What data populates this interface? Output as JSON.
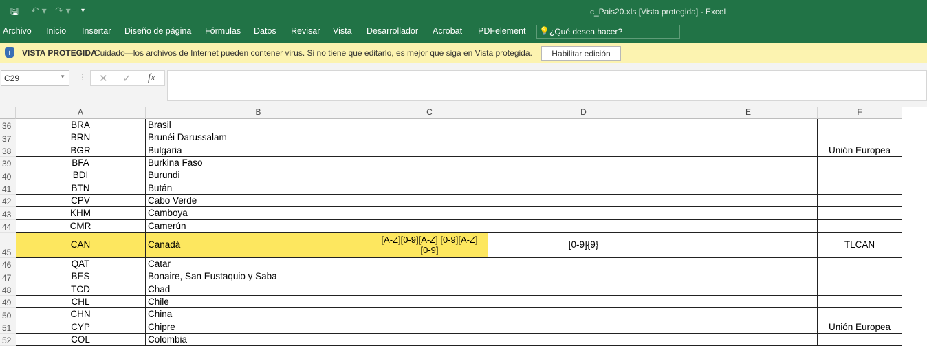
{
  "titlebar": {
    "filename": "c_Pais20.xls  [Vista protegida] - Excel",
    "icons": [
      "save-icon",
      "undo-icon",
      "redo-icon",
      "customize-icon"
    ]
  },
  "ribbon": {
    "tabs": [
      "Archivo",
      "Inicio",
      "Insertar",
      "Diseño de página",
      "Fórmulas",
      "Datos",
      "Revisar",
      "Vista",
      "Desarrollador",
      "Acrobat",
      "PDFelement"
    ],
    "tell_me": "¿Qué desea hacer?"
  },
  "protected": {
    "title": "VISTA PROTEGIDA",
    "message": "Cuidado—los archivos de Internet pueden contener virus. Si no tiene que editarlo, es mejor que siga en Vista protegida.",
    "button": "Habilitar edición"
  },
  "formula_bar": {
    "name_box": "C29",
    "cancel": "✕",
    "enter": "✓",
    "fx": "fx",
    "value": ""
  },
  "columns": [
    "A",
    "B",
    "C",
    "D",
    "E",
    "F"
  ],
  "highlight_color": "#fde75f",
  "rows": [
    {
      "n": "36",
      "A": "BRA",
      "B": "Brasil",
      "C": "",
      "D": "",
      "E": "",
      "F": ""
    },
    {
      "n": "37",
      "A": "BRN",
      "B": "Brunéi Darussalam",
      "C": "",
      "D": "",
      "E": "",
      "F": ""
    },
    {
      "n": "38",
      "A": "BGR",
      "B": "Bulgaria",
      "C": "",
      "D": "",
      "E": "",
      "F": "Unión Europea"
    },
    {
      "n": "39",
      "A": "BFA",
      "B": "Burkina Faso",
      "C": "",
      "D": "",
      "E": "",
      "F": ""
    },
    {
      "n": "40",
      "A": "BDI",
      "B": "Burundi",
      "C": "",
      "D": "",
      "E": "",
      "F": ""
    },
    {
      "n": "41",
      "A": "BTN",
      "B": "Bután",
      "C": "",
      "D": "",
      "E": "",
      "F": ""
    },
    {
      "n": "42",
      "A": "CPV",
      "B": "Cabo Verde",
      "C": "",
      "D": "",
      "E": "",
      "F": ""
    },
    {
      "n": "43",
      "A": "KHM",
      "B": "Camboya",
      "C": "",
      "D": "",
      "E": "",
      "F": ""
    },
    {
      "n": "44",
      "A": "CMR",
      "B": "Camerún",
      "C": "",
      "D": "",
      "E": "",
      "F": ""
    },
    {
      "n": "45",
      "A": "CAN",
      "B": "Canadá",
      "C": "[A-Z][0-9][A-Z] [0-9][A-Z][0-9]",
      "D": "[0-9]{9}",
      "E": "",
      "F": "TLCAN",
      "highlight": true,
      "tall": true
    },
    {
      "n": "46",
      "A": "QAT",
      "B": "Catar",
      "C": "",
      "D": "",
      "E": "",
      "F": ""
    },
    {
      "n": "47",
      "A": "BES",
      "B": "Bonaire, San Eustaquio y Saba",
      "C": "",
      "D": "",
      "E": "",
      "F": ""
    },
    {
      "n": "48",
      "A": "TCD",
      "B": "Chad",
      "C": "",
      "D": "",
      "E": "",
      "F": ""
    },
    {
      "n": "49",
      "A": "CHL",
      "B": "Chile",
      "C": "",
      "D": "",
      "E": "",
      "F": ""
    },
    {
      "n": "50",
      "A": "CHN",
      "B": "China",
      "C": "",
      "D": "",
      "E": "",
      "F": ""
    },
    {
      "n": "51",
      "A": "CYP",
      "B": "Chipre",
      "C": "",
      "D": "",
      "E": "",
      "F": "Unión Europea"
    },
    {
      "n": "52",
      "A": "COL",
      "B": "Colombia",
      "C": "",
      "D": "",
      "E": "",
      "F": ""
    }
  ]
}
